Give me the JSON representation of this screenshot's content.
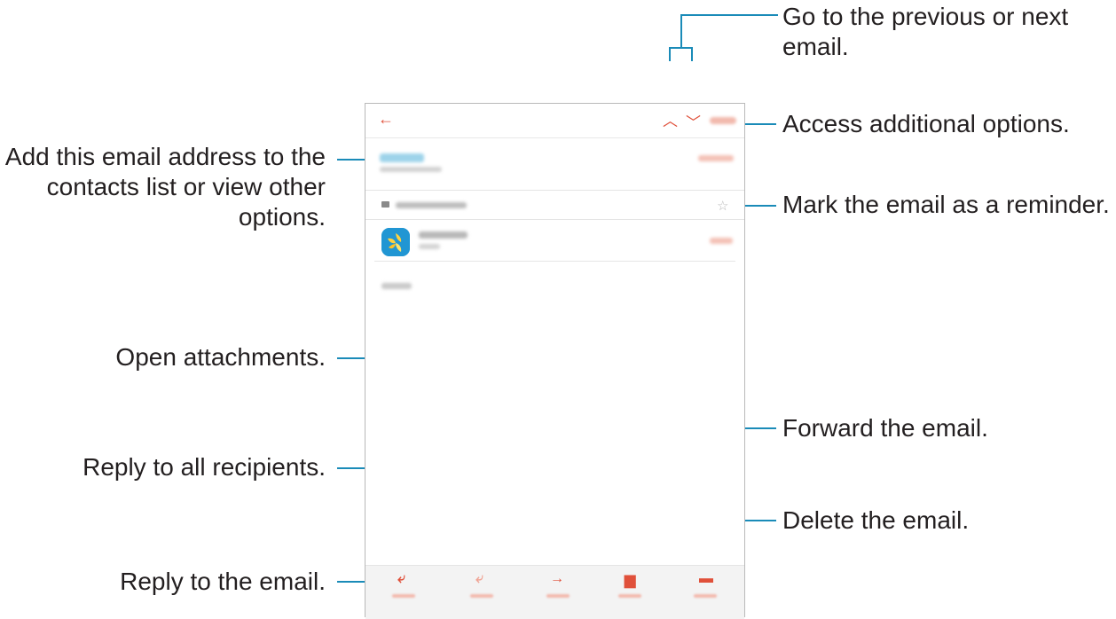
{
  "callouts": {
    "prev_next": "Go to the previous or next\nemail.",
    "more_options": "Access additional options.",
    "add_contact": "Add this email address to the\ncontacts list or view other\noptions.",
    "reminder": "Mark the email as a reminder.",
    "attachments": "Open attachments.",
    "forward": "Forward the email.",
    "reply_all": "Reply to all recipients.",
    "delete": "Delete the email.",
    "reply": "Reply to the email."
  },
  "icons": {
    "back": "back-arrow-icon",
    "previous": "chevron-up-icon",
    "next": "chevron-down-icon",
    "reminder": "star-icon",
    "attachment": "gallery-app-icon",
    "reply": "reply-icon",
    "reply_all": "reply-all-icon",
    "forward": "forward-icon",
    "delete": "trash-icon",
    "more": "message-icon"
  },
  "colors": {
    "accent": "#e0503a",
    "callout_line": "#1a8bb8",
    "text": "#231f20"
  }
}
